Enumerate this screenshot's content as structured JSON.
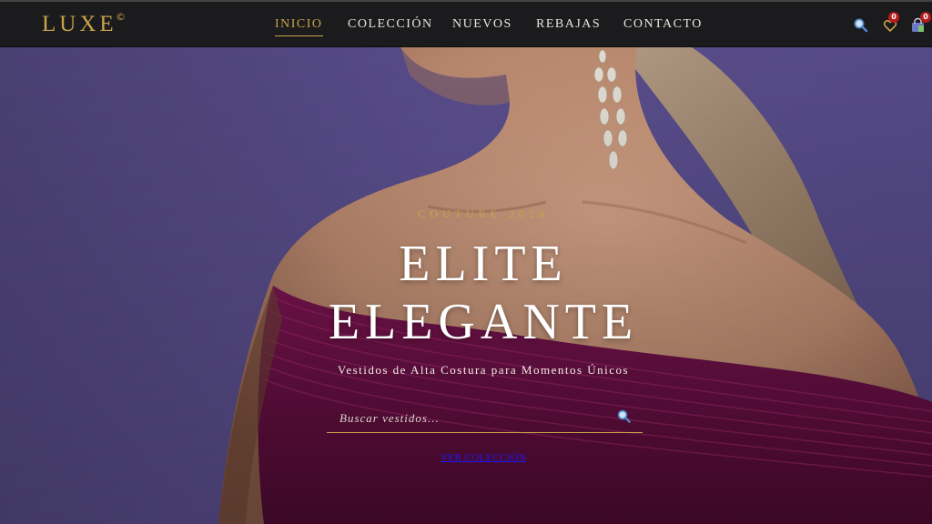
{
  "brand": {
    "name": "LUXE",
    "mark": "©"
  },
  "nav": {
    "items": [
      {
        "label": "INICIO",
        "active": true
      },
      {
        "label": "COLECCIÓN",
        "active": false
      },
      {
        "label": "NUEVOS",
        "active": false
      },
      {
        "label": "REBAJAS",
        "active": false
      },
      {
        "label": "CONTACTO",
        "active": false
      }
    ],
    "icons": {
      "search": "search-icon",
      "wishlist": "heart-icon",
      "cart": "shopping-bag-icon"
    },
    "wishlist_count": "0",
    "cart_count": "0"
  },
  "hero": {
    "eyebrow": "COUTURE 2024",
    "title_line1": "ELITE",
    "title_line2": "ELEGANTE",
    "subtitle": "Vestidos de Alta Costura para Momentos Únicos",
    "search_placeholder": "Buscar vestidos...",
    "cta_label": "VER COLECCIÓN"
  },
  "colors": {
    "accent_gold": "#c9a34a",
    "nav_bg": "#1b1b1d",
    "backdrop_purple": "#5c5090",
    "dress_magenta": "#6e0f45",
    "badge_red": "#b71c1c"
  }
}
